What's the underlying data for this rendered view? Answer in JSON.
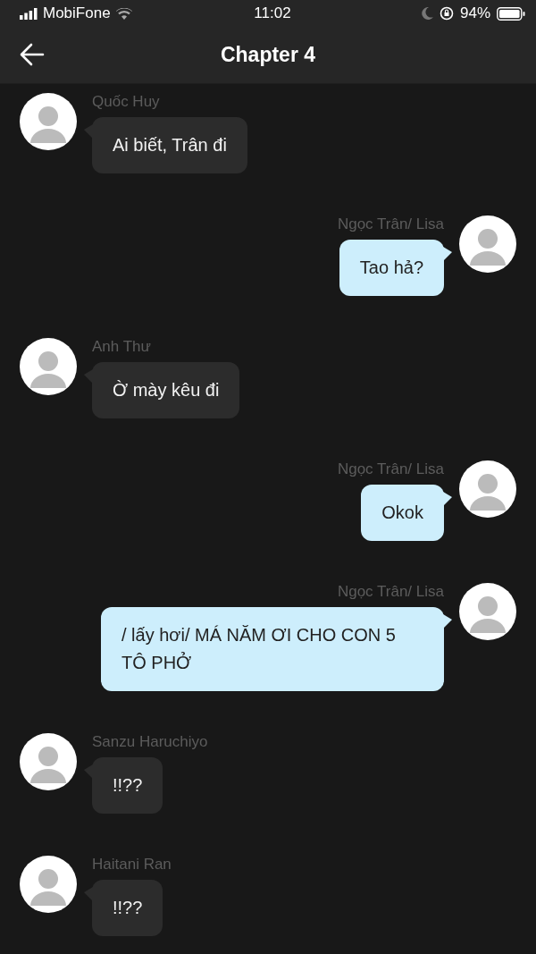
{
  "status_bar": {
    "carrier": "MobiFone",
    "time": "11:02",
    "battery": "94%"
  },
  "header": {
    "title": "Chapter 4"
  },
  "messages": [
    {
      "kind": "received",
      "sender": "Quốc Huy",
      "text": "Ai biết, Trân đi"
    },
    {
      "kind": "sent",
      "sender": "Ngọc Trân/ Lisa",
      "text": "Tao hả?"
    },
    {
      "kind": "received",
      "sender": "Anh Thư",
      "text": "Ờ mày kêu đi"
    },
    {
      "kind": "sent",
      "sender": "Ngọc Trân/ Lisa",
      "text": "Okok"
    },
    {
      "kind": "sent",
      "sender": "Ngọc Trân/ Lisa",
      "text": "/ lấy hơi/ MÁ NĂM ƠI CHO CON 5 TÔ PHỞ"
    },
    {
      "kind": "received",
      "sender": "Sanzu Haruchiyo",
      "text": "!!??"
    },
    {
      "kind": "received",
      "sender": "Haitani Ran",
      "text": "!!??"
    }
  ]
}
